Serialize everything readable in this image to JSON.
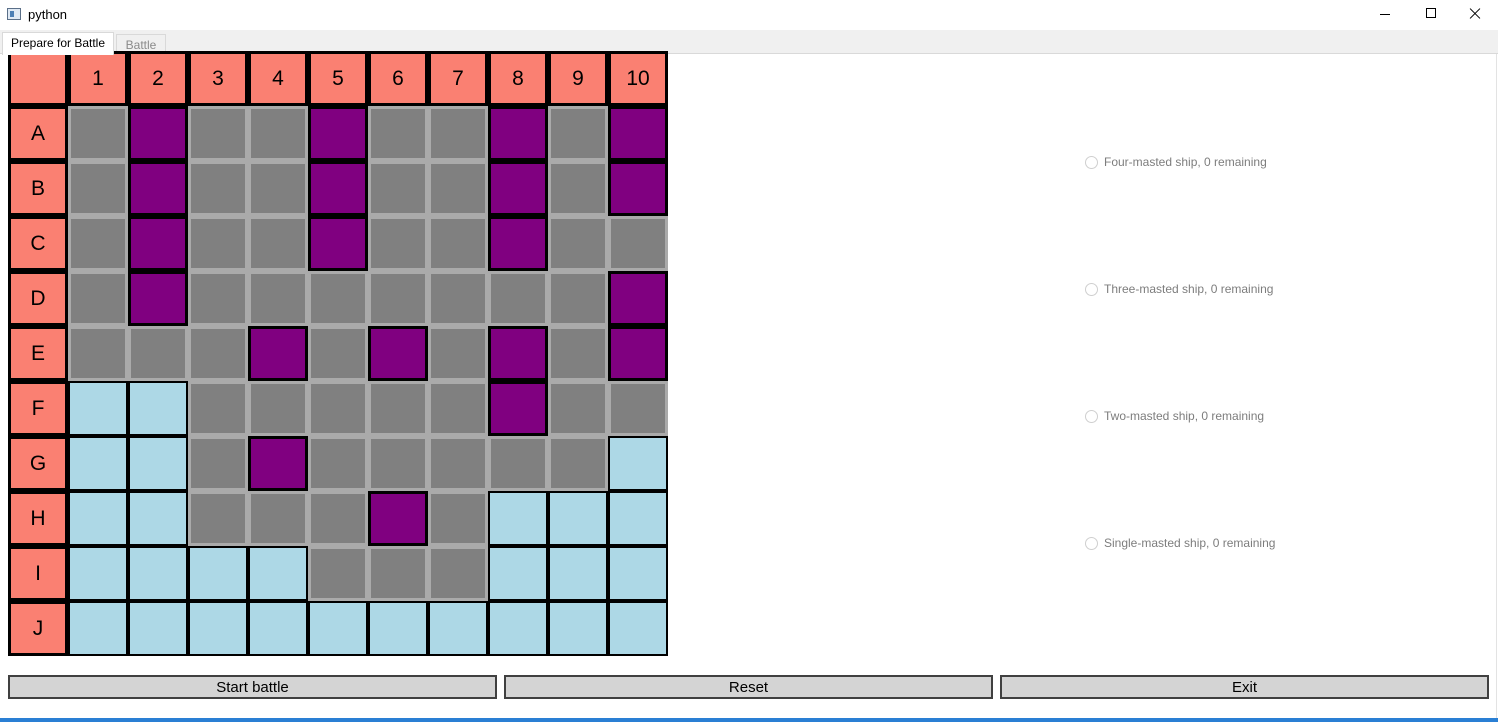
{
  "window": {
    "title": "python",
    "icon": "app-window-icon",
    "controls": [
      "minimize-icon",
      "maximize-icon",
      "close-icon"
    ]
  },
  "tabs": [
    {
      "label": "Prepare for Battle",
      "active": true
    },
    {
      "label": "Battle",
      "active": false
    }
  ],
  "board": {
    "corner": "",
    "columns": [
      "1",
      "2",
      "3",
      "4",
      "5",
      "6",
      "7",
      "8",
      "9",
      "10"
    ],
    "rows": [
      "A",
      "B",
      "C",
      "D",
      "E",
      "F",
      "G",
      "H",
      "I",
      "J"
    ],
    "cell_legend": {
      "S": "ship",
      "G": "blocked",
      "W": "water"
    },
    "cells": [
      "GSGGSGGSGS",
      "GSGGSGGSGS",
      "GSGGSGGSGG",
      "GSGGGGGGGS",
      "GGGSGSGSGS",
      "WWGGGGGSGG",
      "WWGSGGGGGW",
      "WWGGGSGWWW",
      "WWWWGGGWWW",
      "WWWWWWWWWW"
    ],
    "colors": {
      "header": "#fa8072",
      "ship": "#800080",
      "blocked": "#808080",
      "water": "#add8e6"
    }
  },
  "ship_options": [
    {
      "label": "Four-masted ship, 0 remaining",
      "selected": false
    },
    {
      "label": "Three-masted ship, 0 remaining",
      "selected": false
    },
    {
      "label": "Two-masted ship, 0 remaining",
      "selected": false
    },
    {
      "label": "Single-masted ship, 0 remaining",
      "selected": false
    }
  ],
  "buttons": {
    "start": "Start battle",
    "reset": "Reset",
    "exit": "Exit"
  }
}
